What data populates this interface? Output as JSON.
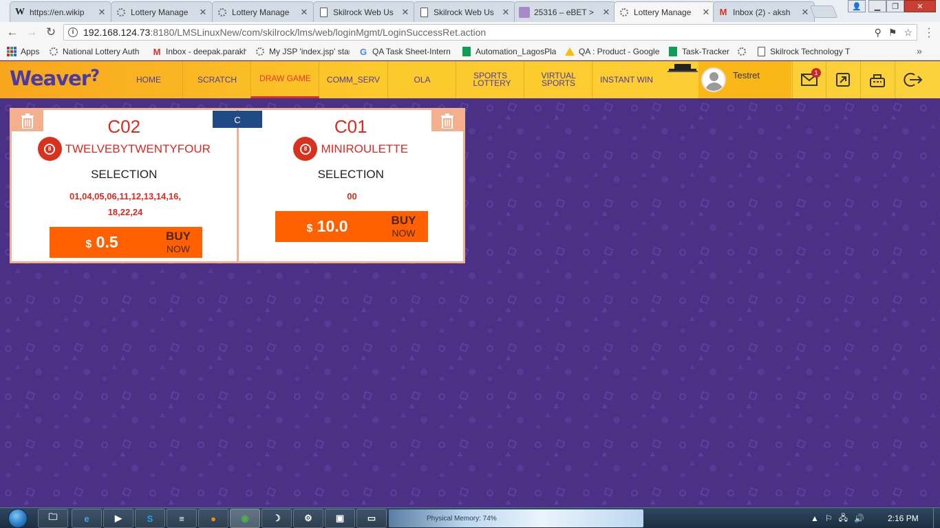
{
  "browser": {
    "tabs": [
      {
        "title": "https://en.wikip",
        "icon": "wikipedia-icon"
      },
      {
        "title": "Lottery Manage",
        "icon": "loading-icon"
      },
      {
        "title": "Lottery Manage",
        "icon": "loading-icon"
      },
      {
        "title": "Skilrock Web Us",
        "icon": "document-icon"
      },
      {
        "title": "Skilrock Web Us",
        "icon": "document-icon"
      },
      {
        "title": "25316 – eBET >",
        "icon": "image-icon"
      },
      {
        "title": "Lottery Manage",
        "icon": "loading-icon",
        "active": true
      },
      {
        "title": "Inbox (2) - aksh",
        "icon": "gmail-icon"
      }
    ],
    "url_host": "192.168.124.73",
    "url_path": ":8180/LMSLinuxNew/com/skilrock/lms/web/loginMgmt/LoginSuccessRet.action",
    "bookmarks": [
      {
        "label": "Apps",
        "icon": "apps-icon"
      },
      {
        "label": "National Lottery Auth",
        "icon": "loading-icon"
      },
      {
        "label": "Inbox - deepak.parakh",
        "icon": "gmail-icon"
      },
      {
        "label": "My JSP 'index.jsp' star",
        "icon": "loading-icon"
      },
      {
        "label": "QA Task Sheet-Intern",
        "icon": "google-icon"
      },
      {
        "label": "Automation_LagosPla",
        "icon": "sheets-icon"
      },
      {
        "label": "QA : Product - Google",
        "icon": "drive-icon"
      },
      {
        "label": "Task-Tracker",
        "icon": "sheets-icon"
      },
      {
        "label": "",
        "icon": "loading-icon"
      },
      {
        "label": "Skilrock Technology T",
        "icon": "document-icon"
      }
    ]
  },
  "app": {
    "logo": "Weaver",
    "nav": [
      "HOME",
      "SCRATCH",
      "DRAW GAME",
      "COMM_SERV",
      "OLA",
      "SPORTS LOTTERY",
      "VIRTUAL SPORTS",
      "INSTANT WIN"
    ],
    "active_nav": "DRAW GAME",
    "username": "Testret",
    "notification_count": "1",
    "colors": {
      "header": "#fbc82e",
      "accent": "#ff6100",
      "brand": "#4b3aa1",
      "background": "#4a3186",
      "red": "#d72b1f"
    }
  },
  "cart": {
    "clear_label": "C",
    "tickets": [
      {
        "code": "C02",
        "game": "TWELVEBYTWENTYFOUR",
        "selection_label": "SELECTION",
        "numbers_line1": "01,04,05,06,11,12,13,14,16,",
        "numbers_line2": "18,22,24",
        "currency": "$",
        "price": "0.5",
        "buy": "BUY",
        "now": "NOW"
      },
      {
        "code": "C01",
        "game": "MINIROULETTE",
        "selection_label": "SELECTION",
        "numbers_line1": "00",
        "numbers_line2": "",
        "currency": "$",
        "price": "10.0",
        "buy": "BUY",
        "now": "NOW"
      }
    ]
  },
  "taskbar": {
    "memory_text": "Physical Memory: 74%",
    "clock": "2:16 PM"
  }
}
